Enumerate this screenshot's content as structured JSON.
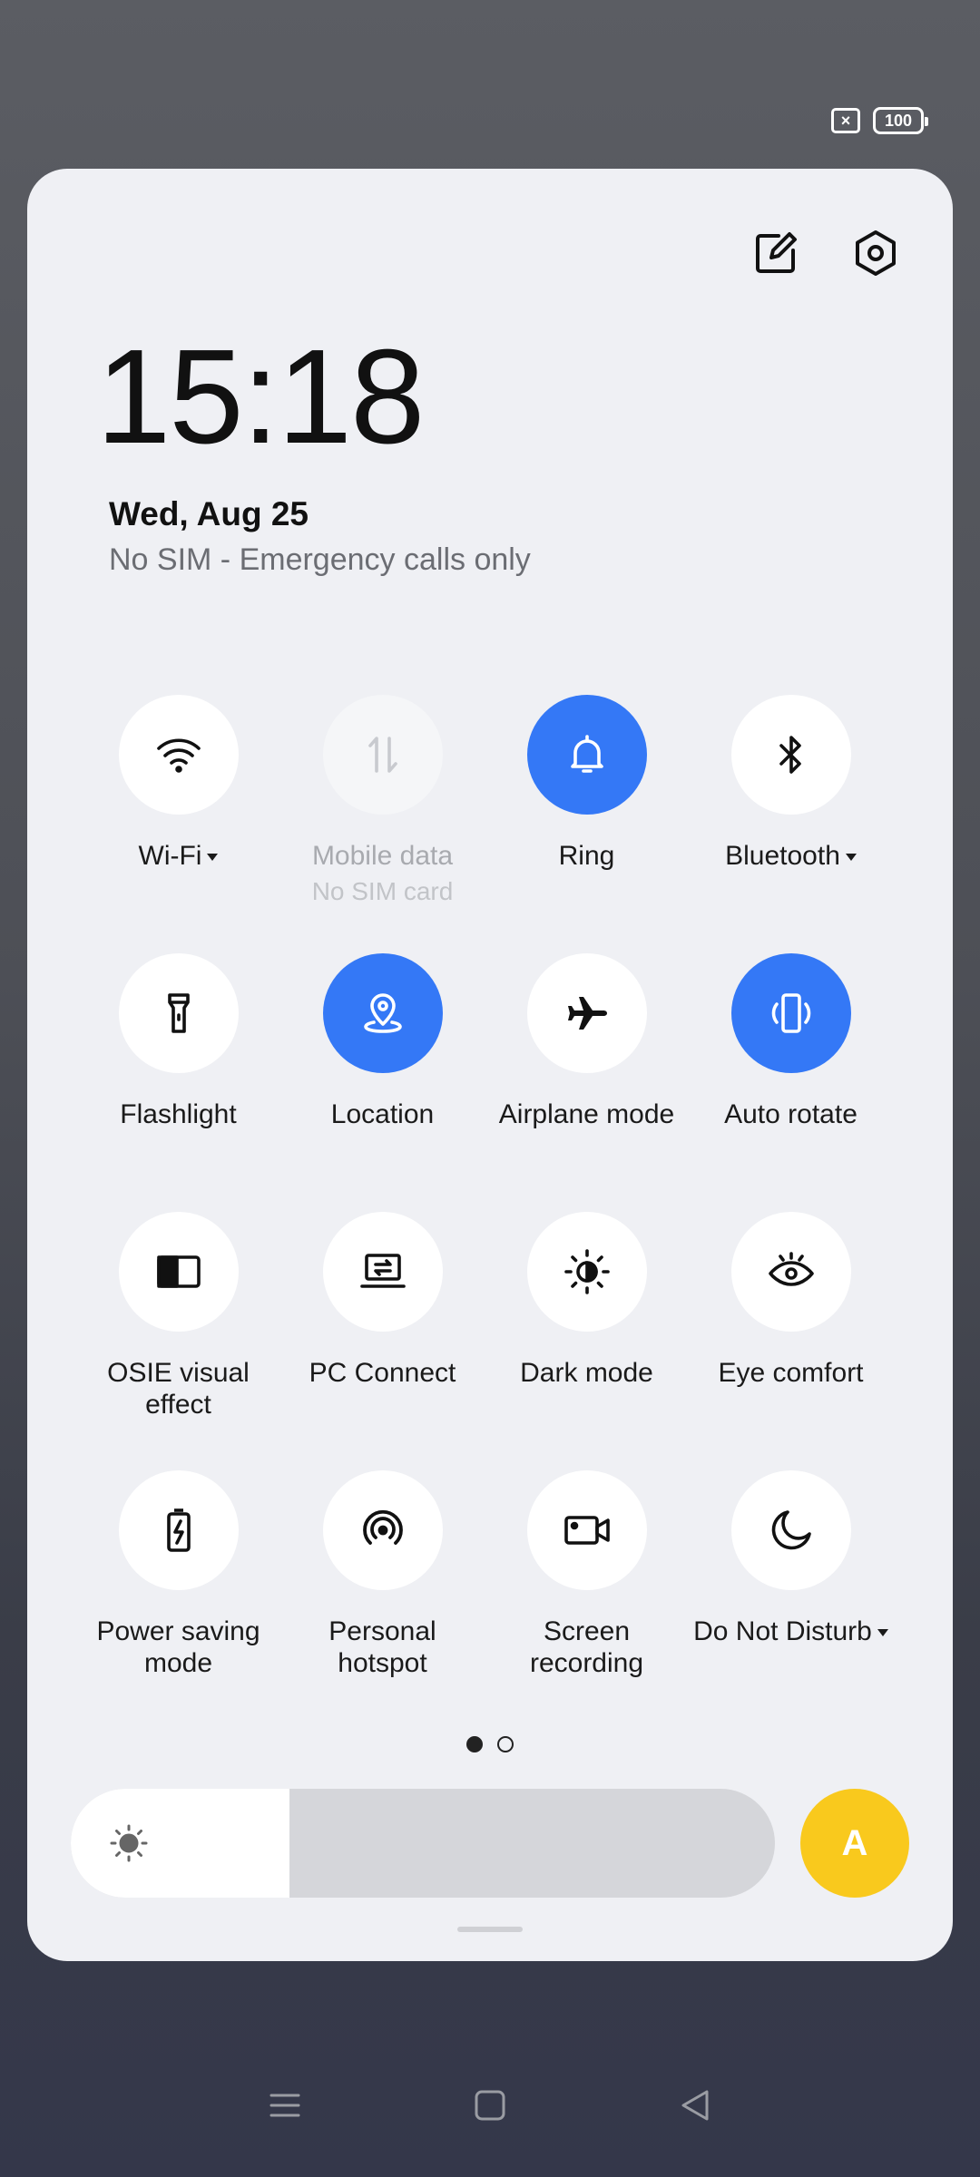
{
  "status_bar": {
    "battery_level": "100",
    "sim_icon": "no-sim-icon"
  },
  "panel": {
    "clock": "15:18",
    "date": "Wed, Aug 25",
    "sim_status": "No SIM - Emergency calls only",
    "top_icons": [
      "edit-icon",
      "settings-gear-icon"
    ]
  },
  "tiles": {
    "wifi": {
      "label": "Wi-Fi",
      "state": "off",
      "has_dropdown": true
    },
    "mobile_data": {
      "label": "Mobile data",
      "sublabel": "No SIM card",
      "state": "disabled"
    },
    "ring": {
      "label": "Ring",
      "state": "on"
    },
    "bluetooth": {
      "label": "Bluetooth",
      "state": "off",
      "has_dropdown": true
    },
    "flashlight": {
      "label": "Flashlight",
      "state": "off"
    },
    "location": {
      "label": "Location",
      "state": "on"
    },
    "airplane": {
      "label": "Airplane mode",
      "state": "off"
    },
    "auto_rotate": {
      "label": "Auto rotate",
      "state": "on"
    },
    "osie": {
      "label_line1": "OSIE visual",
      "label_line2": "effect",
      "state": "off"
    },
    "pc_connect": {
      "label": "PC Connect",
      "state": "off"
    },
    "dark_mode": {
      "label": "Dark mode",
      "state": "off"
    },
    "eye_comfort": {
      "label": "Eye comfort",
      "state": "off"
    },
    "power_saving": {
      "label_line1": "Power saving",
      "label_line2": "mode",
      "state": "off"
    },
    "hotspot": {
      "label_line1": "Personal",
      "label_line2": "hotspot",
      "state": "off"
    },
    "screen_recording": {
      "label_line1": "Screen",
      "label_line2": "recording",
      "state": "off"
    },
    "dnd": {
      "label": "Do Not Disturb",
      "state": "off",
      "has_dropdown": true
    }
  },
  "pagination": {
    "current_page": 1,
    "total_pages": 2
  },
  "brightness": {
    "level_fraction": 0.31,
    "auto_label": "A"
  },
  "colors": {
    "accent": "#3478f6",
    "auto_brightness": "#f9c91d",
    "panel_bg": "#eff0f4"
  },
  "nav_bar": [
    "menu-icon",
    "home-icon",
    "back-icon"
  ]
}
